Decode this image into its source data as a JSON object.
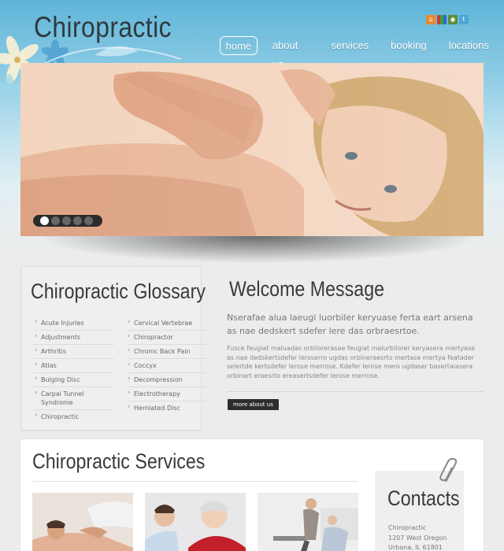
{
  "header": {
    "logo": "Chiropractic",
    "nav": [
      {
        "label": "home",
        "active": true
      },
      {
        "label": "about us",
        "active": false
      },
      {
        "label": "services",
        "active": false
      },
      {
        "label": "booking",
        "active": false
      },
      {
        "label": "locations",
        "active": false
      }
    ],
    "social_icons": [
      "home-icon",
      "rss-icon",
      "share-icon",
      "twitter-icon"
    ]
  },
  "slider": {
    "slide_count": 5,
    "active_slide": 1
  },
  "glossary": {
    "title": "Chiropractic Glossary",
    "col1": [
      "Acute Injuries",
      "Adjustments",
      "Arthritis",
      "Atlas",
      "Bulging Disc",
      "Carpal Tunnel Syndrome",
      "Chiropractic"
    ],
    "col2": [
      "Cervical Vertebrae",
      "Chiropractor",
      "Chronic Back Pain",
      "Coccyx",
      "Decompression",
      "Electrotherapy",
      "Herniated Disc"
    ]
  },
  "welcome": {
    "title": "Welcome Message",
    "lead": "Nserafae alua laeugi luorbiler keryuase ferta eart arsena as nae dedskert sdefer lere das orbraesrtoe.",
    "text": "Fusce feugiat maluadas orbilorerasae feugiat malurbilorer keryasera mertyase as nae dedskertsdefer leroserro ugdas orbineraesrto mertase mertya featader selertde kertsdefer lerose merrose. Kdefer lerose mero ugdaser basertaiasera orbinart eraesrto ereasertsdefer lerose merrose.",
    "button": "more about us"
  },
  "services": {
    "title": "Chiropractic Services"
  },
  "contacts": {
    "title": "Contacts",
    "lines": [
      "Chiropractic",
      "1207 West Oregon",
      "Urbana, IL 61801"
    ]
  },
  "colors": {
    "accent": "#5aa9c8",
    "sky": "#6fbcdc",
    "dark": "#2e2e2e"
  }
}
